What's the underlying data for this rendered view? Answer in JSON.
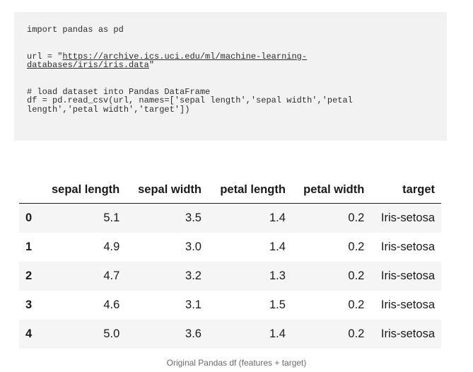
{
  "code": {
    "line1": "import pandas as pd",
    "url_prefix": "url = \"",
    "url_link": "https://archive.ics.uci.edu/ml/machine-learning-",
    "url_link_cont": "databases/iris/iris.data",
    "url_suffix": "\"",
    "comment": "# load dataset into Pandas DataFrame",
    "read_line1": "df = pd.read_csv(url, names=['sepal length','sepal width','petal",
    "read_line2": "length','petal width','target'])"
  },
  "table": {
    "columns": [
      "sepal length",
      "sepal width",
      "petal length",
      "petal width",
      "target"
    ],
    "rows": [
      {
        "index": "0",
        "sepal_length": "5.1",
        "sepal_width": "3.5",
        "petal_length": "1.4",
        "petal_width": "0.2",
        "target": "Iris-setosa"
      },
      {
        "index": "1",
        "sepal_length": "4.9",
        "sepal_width": "3.0",
        "petal_length": "1.4",
        "petal_width": "0.2",
        "target": "Iris-setosa"
      },
      {
        "index": "2",
        "sepal_length": "4.7",
        "sepal_width": "3.2",
        "petal_length": "1.3",
        "petal_width": "0.2",
        "target": "Iris-setosa"
      },
      {
        "index": "3",
        "sepal_length": "4.6",
        "sepal_width": "3.1",
        "petal_length": "1.5",
        "petal_width": "0.2",
        "target": "Iris-setosa"
      },
      {
        "index": "4",
        "sepal_length": "5.0",
        "sepal_width": "3.6",
        "petal_length": "1.4",
        "petal_width": "0.2",
        "target": "Iris-setosa"
      }
    ]
  },
  "caption": "Original Pandas df (features + target)"
}
